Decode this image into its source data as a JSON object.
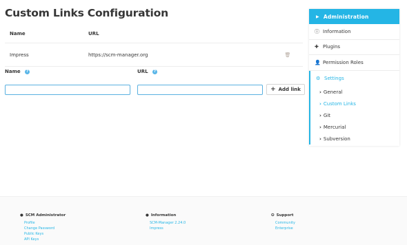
{
  "page": {
    "title": "Custom Links Configuration"
  },
  "table": {
    "headers": {
      "name": "Name",
      "url": "URL"
    },
    "rows": [
      {
        "name": "Impress",
        "url": "https://scm-manager.org"
      }
    ]
  },
  "form": {
    "name_label": "Name",
    "url_label": "URL",
    "name_value": "",
    "url_value": "",
    "add_button_label": "Add link"
  },
  "sidebar": {
    "header": "Administration",
    "items": [
      {
        "label": "Information",
        "icon": "info-circle-icon"
      },
      {
        "label": "Plugins",
        "icon": "puzzle-icon"
      },
      {
        "label": "Permission Roles",
        "icon": "user-shield-icon"
      }
    ],
    "settings": {
      "label": "Settings",
      "icon": "gear-icon",
      "subitems": [
        {
          "label": "General"
        },
        {
          "label": "Custom Links",
          "active": true
        },
        {
          "label": "Git"
        },
        {
          "label": "Mercurial"
        },
        {
          "label": "Subversion"
        }
      ]
    }
  },
  "footer": {
    "admin": {
      "title": "SCM Administrator",
      "links": [
        "Profile",
        "Change Password",
        "Public Keys",
        "API Keys"
      ]
    },
    "information": {
      "title": "Information",
      "links": [
        "SCM-Manager 2.24.0",
        "Impress"
      ]
    },
    "support": {
      "title": "Support",
      "links": [
        "Community",
        "Enterprise"
      ]
    }
  },
  "colors": {
    "accent": "#24b5e5",
    "input_border": "#59b0e0",
    "trash": "#b5a99f"
  }
}
